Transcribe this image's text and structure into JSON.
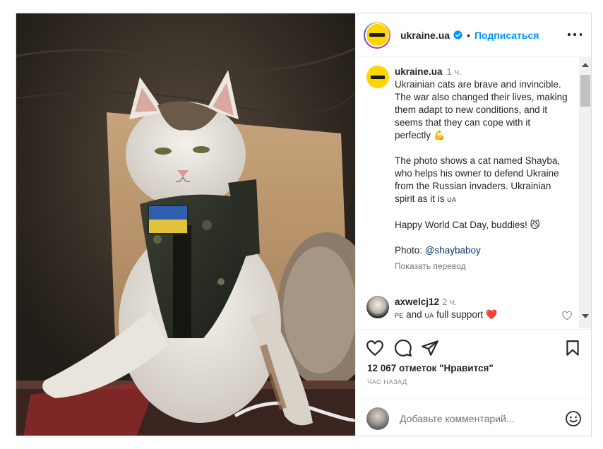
{
  "post": {
    "account": {
      "username": "ukraine.ua",
      "verified": true,
      "follow_label": "Подписаться",
      "separator": "•"
    },
    "caption": {
      "username": "ukraine.ua",
      "time": "1 ч.",
      "paragraph1": "Ukrainian cats are brave and invincible. The war also changed their lives, making them adapt to new conditions, and it seems that they can cope with it perfectly",
      "paragraph1_emoji": "💪",
      "paragraph2": "The photo shows a cat named Shayba, who helps his owner to defend Ukraine from the Russian invaders. Ukrainian spirit as it is",
      "paragraph2_flag": "UA",
      "paragraph3": "Happy World Cat Day, buddies!",
      "paragraph3_emoji": "😼",
      "photo_label": "Photo: ",
      "photo_credit": "@shaybaboy",
      "translate_label": "Показать перевод"
    },
    "comment": {
      "username": "axwelcj12",
      "time": "2 ч.",
      "text_part1": "PE",
      "text_part2": " and ",
      "text_part3": "UA",
      "text_part4": " full support ",
      "heart": "❤️"
    },
    "actions": {
      "likes": "12 067 отметок \"Нравится\"",
      "ago": "ЧАС НАЗАД"
    },
    "add_comment": {
      "placeholder": "Добавьте комментарий..."
    },
    "icons": {
      "like": "heart-outline-icon",
      "comment": "comment-bubble-icon",
      "share": "paper-plane-icon",
      "save": "bookmark-icon",
      "more": "ellipsis-icon",
      "verified": "verified-badge-icon",
      "emoji": "smiley-icon"
    },
    "colors": {
      "link": "#0095f6",
      "mention": "#00376b",
      "muted": "#8e8e8e",
      "brand_yellow": "#ffd500"
    }
  }
}
